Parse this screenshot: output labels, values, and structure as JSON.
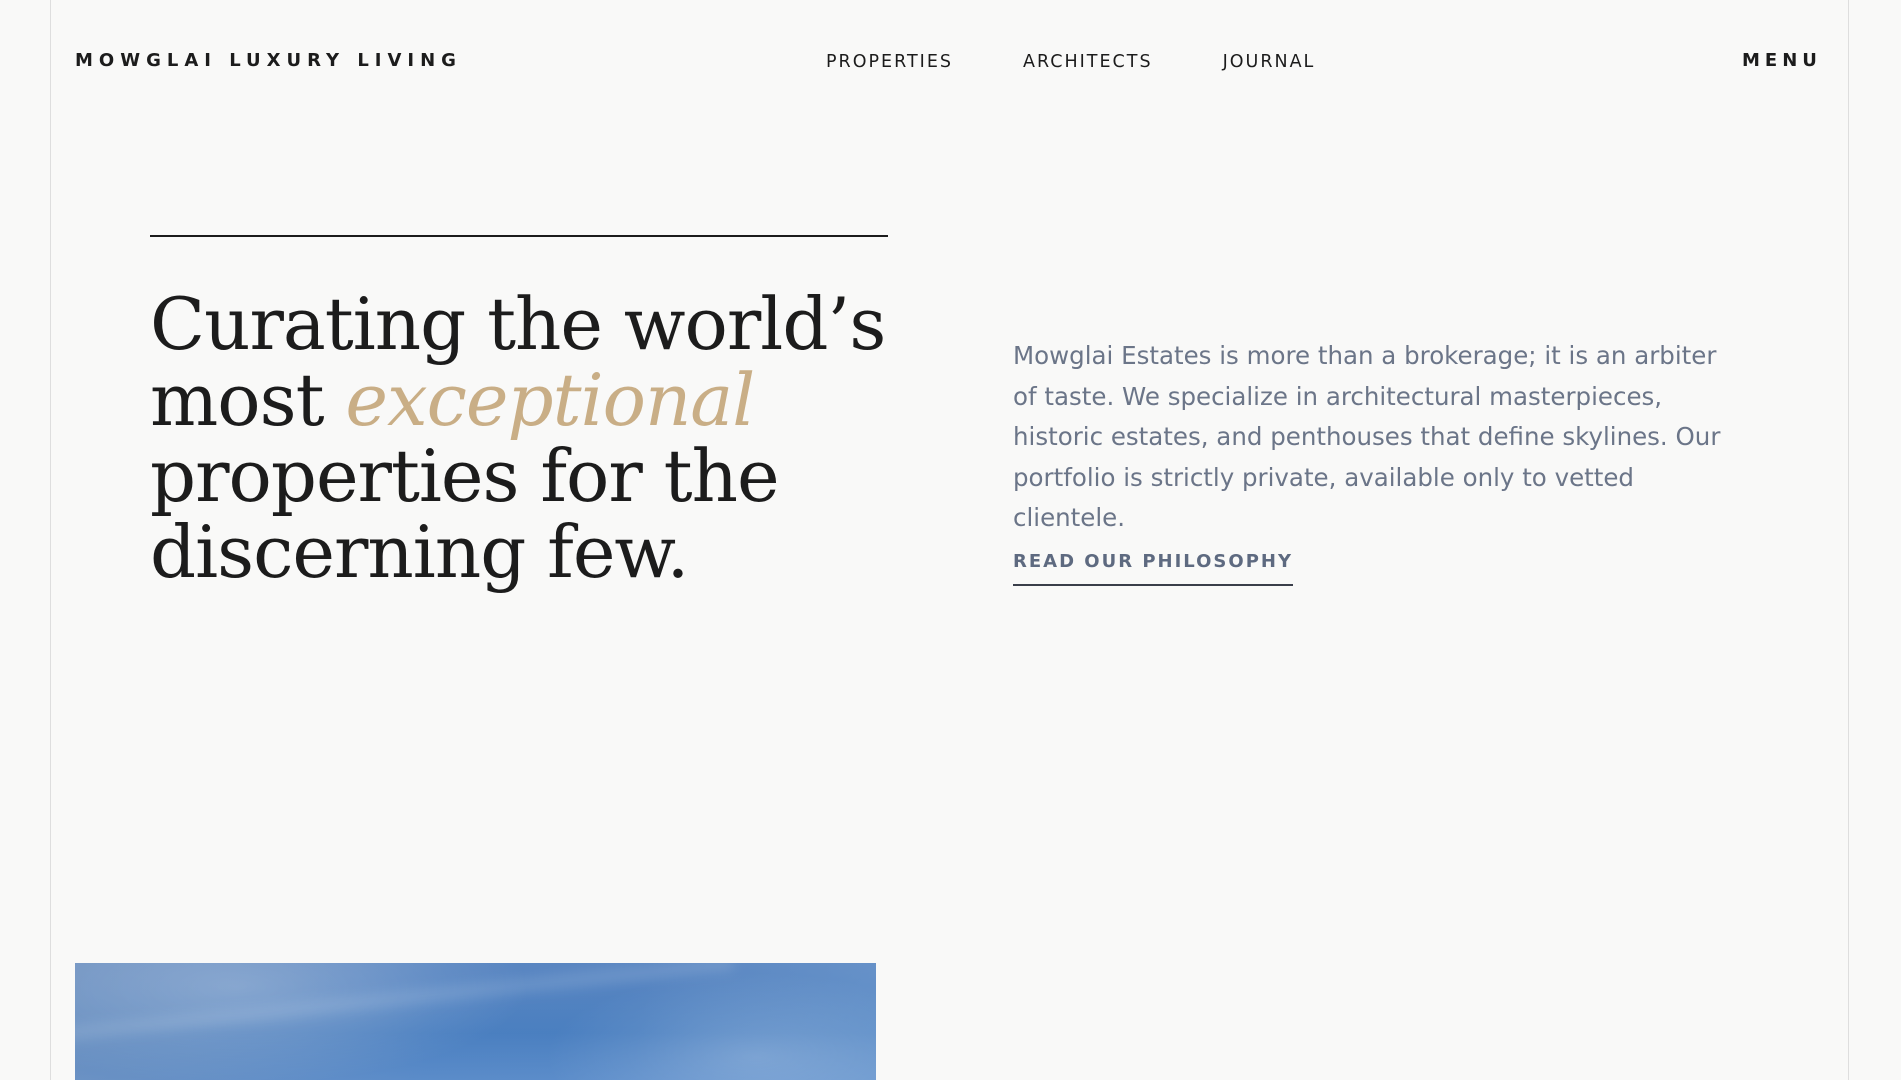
{
  "header": {
    "brand": "MOWGLAI LUXURY LIVING",
    "nav": [
      "PROPERTIES",
      "ARCHITECTS",
      "JOURNAL"
    ],
    "menu_label": "MENU"
  },
  "hero": {
    "headline_line1": "Curating the world’s",
    "headline_line2_prefix": "most ",
    "headline_accent": "exceptional",
    "headline_line3": "properties for the",
    "headline_line4": "discerning few.",
    "intro": "Mowglai Estates is more than a brokerage; it is an arbiter of taste. We specialize in architectural masterpieces, historic estates, and penthouses that define skylines. Our portfolio is strictly private, available only to vetted clientele.",
    "cta_label": "READ OUR PHILOSOPHY"
  },
  "colors": {
    "background": "#f9f9f8",
    "text": "#1c1c1c",
    "accent_gold": "#c9ae86",
    "muted_slate": "#6b7588"
  }
}
